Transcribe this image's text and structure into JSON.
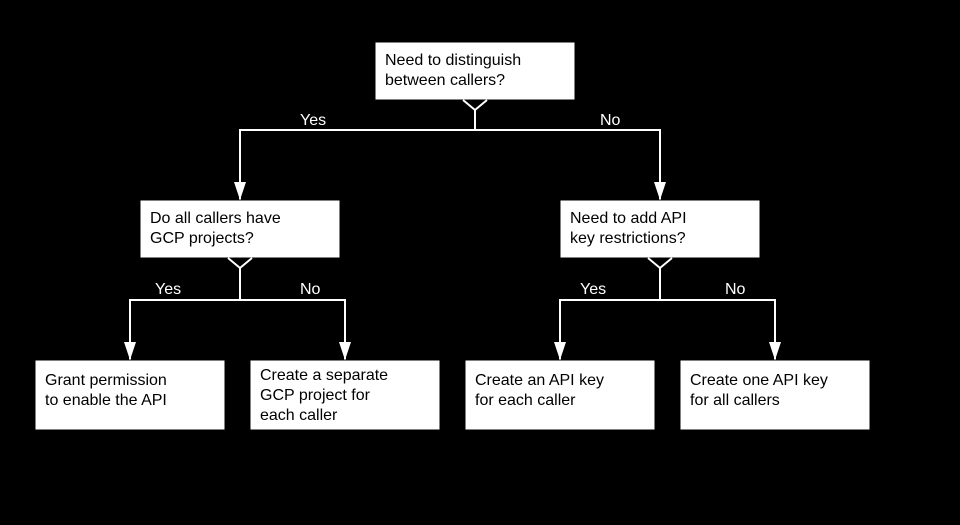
{
  "chart_data": {
    "type": "flowchart",
    "nodes": [
      {
        "id": "root",
        "text_l1": "Need to distinguish",
        "text_l2": "between callers?"
      },
      {
        "id": "q_gcp",
        "text_l1": "Do all callers have",
        "text_l2": "GCP projects?"
      },
      {
        "id": "q_key",
        "text_l1": "Need to add API",
        "text_l2": "key restrictions?"
      },
      {
        "id": "a1",
        "text_l1": "Grant permission",
        "text_l2": "to enable the API"
      },
      {
        "id": "a2",
        "text_l1": "Create a separate",
        "text_l2": "GCP project for",
        "text_l3": "each caller"
      },
      {
        "id": "a3",
        "text_l1": "Create an API key",
        "text_l2": "for each caller"
      },
      {
        "id": "a4",
        "text_l1": "Create one API key",
        "text_l2": "for all callers"
      }
    ],
    "edges": [
      {
        "from": "root",
        "to": "q_gcp",
        "label": "Yes"
      },
      {
        "from": "root",
        "to": "q_key",
        "label": "No"
      },
      {
        "from": "q_gcp",
        "to": "a1",
        "label": "Yes"
      },
      {
        "from": "q_gcp",
        "to": "a2",
        "label": "No"
      },
      {
        "from": "q_key",
        "to": "a3",
        "label": "Yes"
      },
      {
        "from": "q_key",
        "to": "a4",
        "label": "No"
      }
    ]
  }
}
